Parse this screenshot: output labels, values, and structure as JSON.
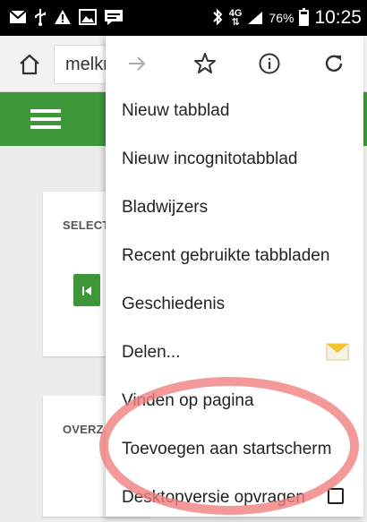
{
  "status_bar": {
    "network": "4G",
    "battery_pct": "76%",
    "time": "10:25"
  },
  "browser": {
    "url_text": "melkr"
  },
  "page": {
    "card1_label": "SELECT",
    "card2_label": "OVERZ",
    "brand_color": "#3d9637"
  },
  "menu": {
    "items": [
      {
        "label": "Nieuw tabblad"
      },
      {
        "label": "Nieuw incognitotabblad"
      },
      {
        "label": "Bladwijzers"
      },
      {
        "label": "Recent gebruikte tabbladen"
      },
      {
        "label": "Geschiedenis"
      },
      {
        "label": "Delen..."
      },
      {
        "label": "Vinden op pagina"
      },
      {
        "label": "Toevoegen aan startscherm"
      },
      {
        "label": "Desktopversie opvragen",
        "checked": false
      }
    ]
  },
  "highlight_color": "#f08080"
}
